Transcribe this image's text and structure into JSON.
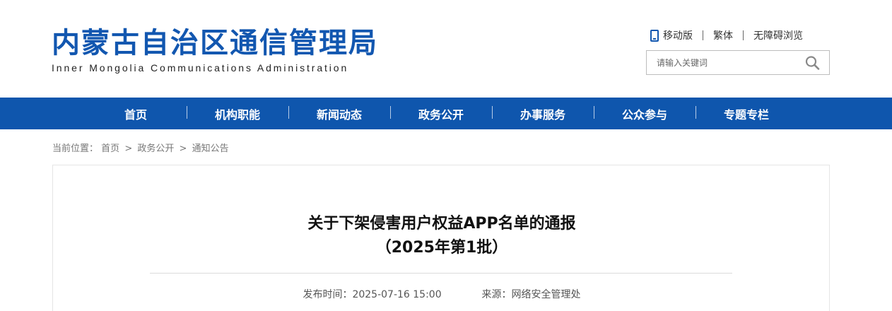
{
  "site": {
    "title_cn": "内蒙古自治区通信管理局",
    "title_en": "Inner Mongolia Communications Administration"
  },
  "toplinks": {
    "mobile": "移动版",
    "traditional": "繁体",
    "accessible": "无障碍浏览"
  },
  "search": {
    "placeholder": "请输入关键词"
  },
  "nav": {
    "items": [
      "首页",
      "机构职能",
      "新闻动态",
      "政务公开",
      "办事服务",
      "公众参与",
      "专题专栏"
    ]
  },
  "breadcrumb": {
    "prefix": "当前位置：",
    "items": [
      "首页",
      "政务公开",
      "通知公告"
    ]
  },
  "article": {
    "title_line1": "关于下架侵害用户权益APP名单的通报",
    "title_line2": "（2025年第1批）",
    "publish_label": "发布时间：",
    "publish_time": "2025-07-16 15:00",
    "source_label": "来源：",
    "source": "网络安全管理处"
  },
  "colors": {
    "brand": "#1257b0",
    "nav_bg": "#0f56ad"
  }
}
